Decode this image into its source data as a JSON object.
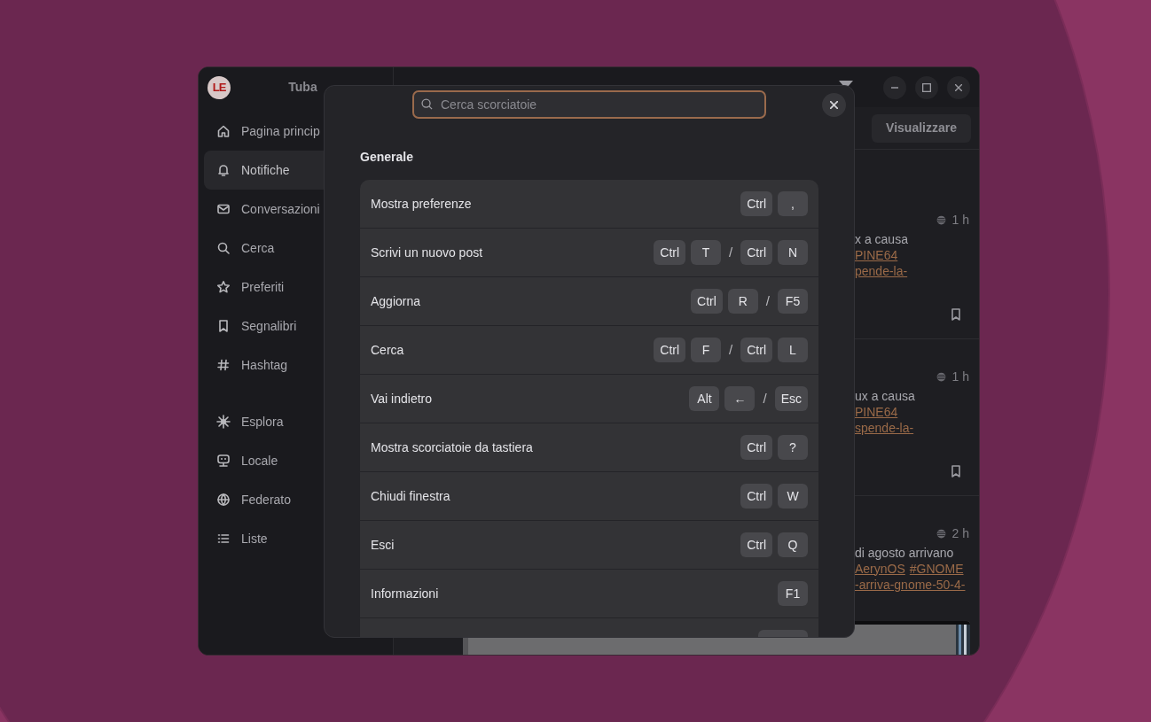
{
  "sidebar": {
    "logo": "LE",
    "title": "Tuba",
    "groups": [
      [
        {
          "label": "Pagina princip",
          "selected": false
        },
        {
          "label": "Notifiche",
          "selected": true
        },
        {
          "label": "Conversazioni",
          "selected": false
        },
        {
          "label": "Cerca",
          "selected": false
        },
        {
          "label": "Preferiti",
          "selected": false
        },
        {
          "label": "Segnalibri",
          "selected": false
        },
        {
          "label": "Hashtag",
          "selected": false
        }
      ],
      [
        {
          "label": "Esplora",
          "selected": false
        },
        {
          "label": "Locale",
          "selected": false
        },
        {
          "label": "Federato",
          "selected": false
        },
        {
          "label": "Liste",
          "selected": false
        }
      ]
    ]
  },
  "toolbar": {
    "button": "Visualizzare"
  },
  "posts": [
    {
      "time": "1 h",
      "lines": [
        [
          {
            "text": "x a causa",
            "link": false
          }
        ],
        [
          {
            "text": "PINE64",
            "link": true
          }
        ],
        [
          {
            "text": "pende-la-",
            "link": true
          }
        ]
      ],
      "bookmark": true,
      "picture": false
    },
    {
      "time": "1 h",
      "lines": [
        [
          {
            "text": "ux a causa",
            "link": false
          }
        ],
        [
          {
            "text": "PINE64",
            "link": true
          }
        ],
        [
          {
            "text": "spende-la-",
            "link": true
          }
        ]
      ],
      "bookmark": true,
      "picture": false
    },
    {
      "time": "2 h",
      "lines": [
        [
          {
            "text": "di agosto arrivano",
            "link": false
          }
        ],
        [
          {
            "text": "AerynOS",
            "link": true
          },
          {
            "text": "#GNOME",
            "link": true
          }
        ],
        [
          {
            "text": "-arriva-gnome-50-4-",
            "link": true
          }
        ]
      ],
      "bookmark": false,
      "picture": true
    }
  ],
  "dialog": {
    "search_placeholder": "Cerca scorciatoie",
    "section": "Generale",
    "shortcuts": [
      {
        "label": "Mostra preferenze",
        "combos": [
          [
            "Ctrl",
            ","
          ]
        ]
      },
      {
        "label": "Scrivi un nuovo post",
        "combos": [
          [
            "Ctrl",
            "T"
          ],
          [
            "Ctrl",
            "N"
          ]
        ]
      },
      {
        "label": "Aggiorna",
        "combos": [
          [
            "Ctrl",
            "R"
          ],
          [
            "F5"
          ]
        ]
      },
      {
        "label": "Cerca",
        "combos": [
          [
            "Ctrl",
            "F"
          ],
          [
            "Ctrl",
            "L"
          ]
        ]
      },
      {
        "label": "Vai indietro",
        "combos": [
          [
            "Alt",
            "←"
          ],
          [
            "Esc"
          ]
        ]
      },
      {
        "label": "Mostra scorciatoie da tastiera",
        "combos": [
          [
            "Ctrl",
            "?"
          ]
        ]
      },
      {
        "label": "Chiudi finestra",
        "combos": [
          [
            "Ctrl",
            "W"
          ]
        ]
      },
      {
        "label": "Esci",
        "combos": [
          [
            "Ctrl",
            "Q"
          ]
        ]
      },
      {
        "label": "Informazioni",
        "combos": [
          [
            "F1"
          ]
        ]
      }
    ],
    "separator": "/"
  }
}
